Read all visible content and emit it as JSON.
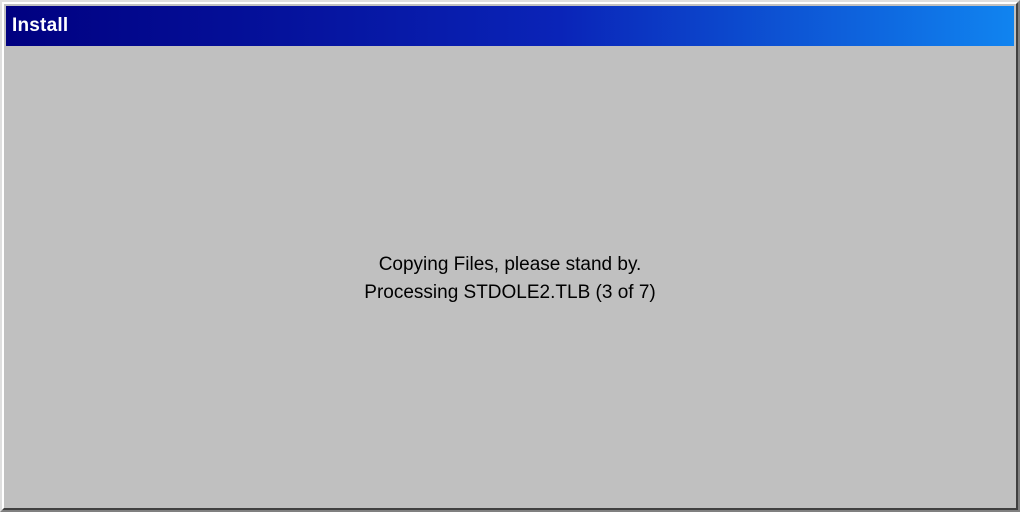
{
  "window": {
    "title": "Install"
  },
  "status": {
    "line1": "Copying Files, please stand by.",
    "line2": "Processing STDOLE2.TLB (3 of 7)"
  },
  "colors": {
    "title_bar_start": "#000080",
    "title_bar_end": "#1084f0",
    "client_background": "#c0c0c0",
    "text": "#000000"
  }
}
